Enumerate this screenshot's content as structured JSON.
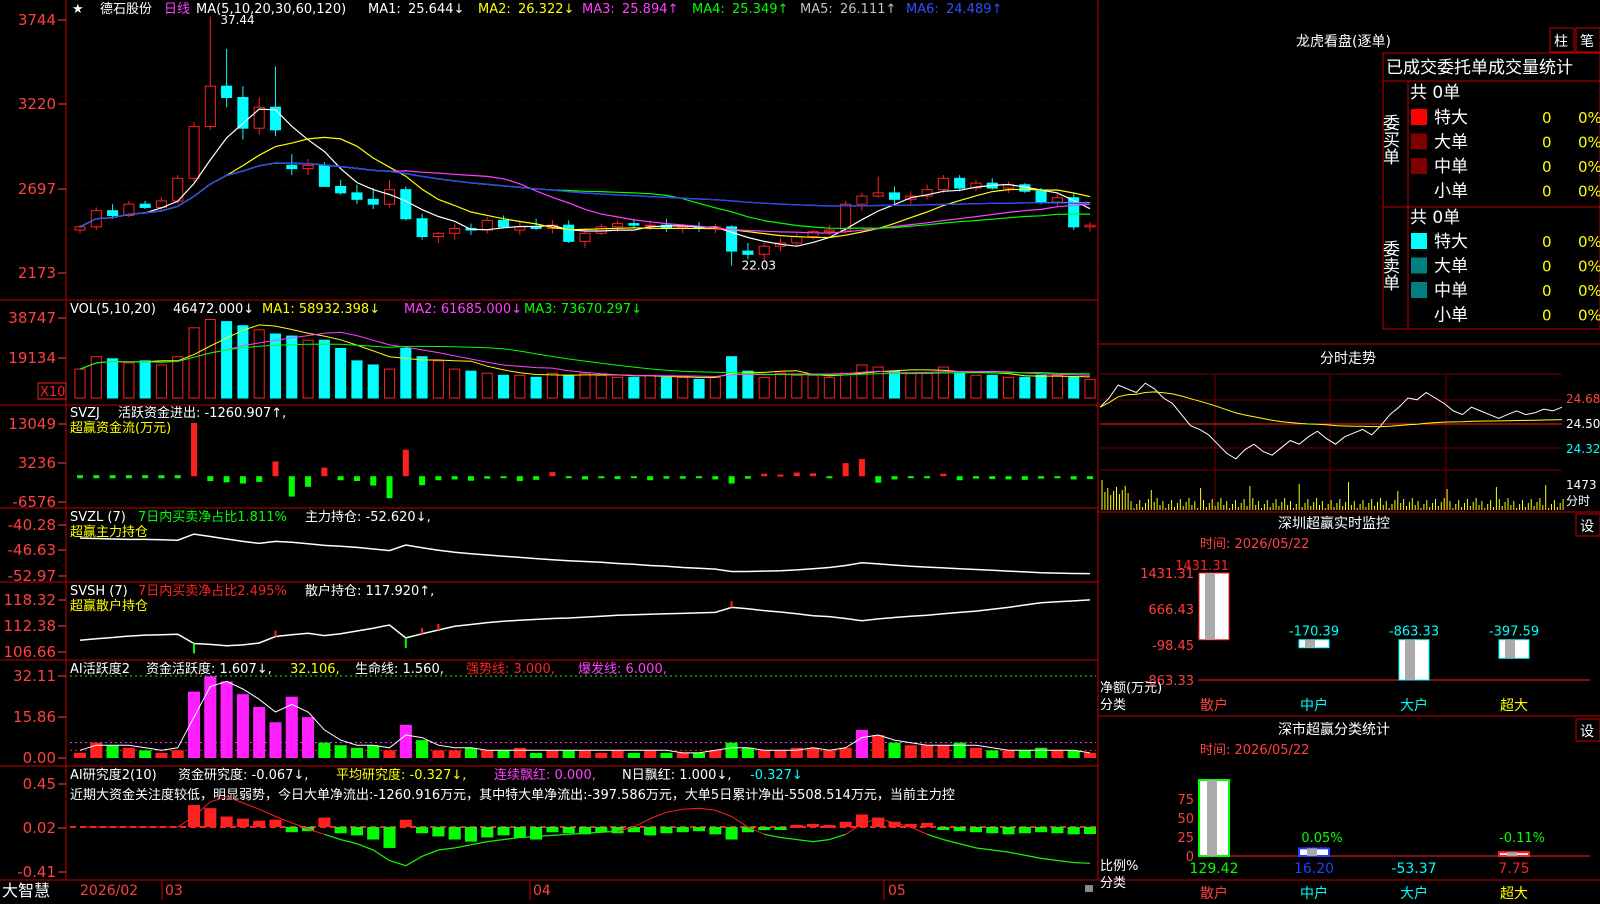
{
  "colors": {
    "up": "#ff2020",
    "down": "#00ffff",
    "grid": "#b00000",
    "axis": "#ff4040",
    "white": "#ffffff",
    "yellow": "#ffff00",
    "magenta": "#ff40ff",
    "green": "#00ff00",
    "blue": "#2040ff",
    "gray": "#c0c0c0"
  },
  "app": {
    "brand": "大智慧",
    "dates": {
      "start": "2026/02",
      "m03": "03",
      "m04": "04",
      "m05": "05"
    }
  },
  "price_panel": {
    "star": "★",
    "stock": "德石股份",
    "period": "日线",
    "ma_spec": "MA(5,10,20,30,60,120)",
    "ma1_label": "MA1:",
    "ma1_val": "25.644↓",
    "ma2_label": "MA2:",
    "ma2_val": "26.322↓",
    "ma3_label": "MA3:",
    "ma3_val": "25.894↑",
    "ma4_label": "MA4:",
    "ma4_val": "25.349↑",
    "ma5_label": "MA5:",
    "ma5_val": "26.111↑",
    "ma6_label": "MA6:",
    "ma6_val": "24.489↑",
    "high_note": "37.44",
    "low_note": "22.03",
    "y_ticks": [
      "3744",
      "3220",
      "2697",
      "2173"
    ],
    "ymax": 37.44,
    "ymin": 21.73
  },
  "vol_panel": {
    "title": "VOL(5,10,20)",
    "val": "46472.000↓",
    "ma1": "MA1: 58932.398↓",
    "ma2": "MA2: 61685.000↓",
    "ma3": "MA3: 73670.297↓",
    "y_ticks": [
      "38747",
      "19134"
    ],
    "scale": "X10"
  },
  "svzj_panel": {
    "title": "SVZJ",
    "label": "活跃资金进出: -1260.907↑,",
    "sub": "超赢资金流(万元)",
    "y_ticks": [
      "13049",
      "3236",
      "-6576"
    ]
  },
  "svzl_panel": {
    "title": "SVZL (7)",
    "label": "7日内买卖净占比1.811%",
    "label2": "主力持仓: -52.620↓,",
    "sub": "超赢主力持仓",
    "y_ticks": [
      "-40.28",
      "-46.63",
      "-52.97"
    ]
  },
  "svsh_panel": {
    "title": "SVSH (7)",
    "label": "7日内买卖净占比2.495%",
    "label2": "散户持仓: 117.920↑,",
    "sub": "超赢散户持仓",
    "y_ticks": [
      "118.32",
      "112.38",
      "106.66"
    ]
  },
  "ai_act_panel": {
    "title": "AI活跃度2",
    "l1": "资金活跃度: 1.607↓,",
    "l2": "32.106,",
    "l3": "生命线: 1.560,",
    "l4": "强势线: 3.000,",
    "l5": "爆发线: 6.000,",
    "y_ticks": [
      "32.11",
      "15.86",
      "0.00"
    ]
  },
  "ai_res_panel": {
    "title": "AI研究度2(10)",
    "l1": "资金研究度: -0.067↓,",
    "l2": "平均研究度: -0.327↓,",
    "l3": "连续飘红: 0.000,",
    "l4": "N日飘红: 1.000↓,",
    "l5": "-0.327↓",
    "note": "近期大资金关注度较低，明显弱势，今日大单净流出:-1260.916万元，其中特大单净流出:-397.586万元，大单5日累计净出-5508.514万元，当前主力控",
    "y_ticks": [
      "0.45",
      "0.02",
      "-0.41"
    ]
  },
  "lhb": {
    "title": "龙虎看盘(逐单)",
    "btn1": "柱",
    "btn2": "笔",
    "header": "已成交委托单成交量统计",
    "buy_side": "委买单",
    "sell_side": "委卖单",
    "buy_total": "共 0单",
    "sell_total": "共 0单",
    "buy_rows": [
      {
        "name": "特大",
        "n": "0",
        "p": "0%"
      },
      {
        "name": "大单",
        "n": "0",
        "p": "0%"
      },
      {
        "name": "中单",
        "n": "0",
        "p": "0%"
      },
      {
        "name": "小单",
        "n": "0",
        "p": "0%"
      }
    ],
    "sell_rows": [
      {
        "name": "特大",
        "n": "0",
        "p": "0%"
      },
      {
        "name": "大单",
        "n": "0",
        "p": "0%"
      },
      {
        "name": "中单",
        "n": "0",
        "p": "0%"
      },
      {
        "name": "小单",
        "n": "0",
        "p": "0%"
      }
    ]
  },
  "intraday": {
    "title": "分时走势",
    "y_ticks": [
      "24.68",
      "24.50",
      "24.32"
    ],
    "vol_tick": "1473",
    "vol_unit": "分时"
  },
  "sz_monitor": {
    "title": "深圳超赢实时监控",
    "btn": "设",
    "time": "时间: 2026/05/22",
    "y_ticks": [
      "1431.31",
      "666.43",
      "-98.45",
      "-863.33"
    ],
    "unit": "净额(万元)",
    "cat_label": "分类",
    "categories": [
      "散户",
      "中户",
      "大户",
      "超大"
    ],
    "values": [
      1431.31,
      -170.39,
      -863.33,
      -397.59
    ],
    "labels": [
      "1431.31",
      "-170.39",
      "-863.33",
      "-397.59"
    ]
  },
  "sh_stats": {
    "title": "深市超赢分类统计",
    "btn": "设",
    "time": "时间: 2026/05/22",
    "y_ticks": [
      "75",
      "50",
      "25",
      "0"
    ],
    "unit": "比例%",
    "cat_label": "分类",
    "categories": [
      "散户",
      "中户",
      "大户",
      "超大"
    ],
    "pcts": [
      0,
      0.05,
      0,
      0.11
    ],
    "pct_labels": [
      "",
      "0.05%",
      "",
      "-0.11%"
    ],
    "values": [
      "129.42",
      "16.20",
      "-53.37",
      "7.75"
    ]
  },
  "chart_data": {
    "type": "candlestick",
    "x_start": "2026/02",
    "month_labels": [
      "2026/02",
      "03",
      "04",
      "05"
    ],
    "ohlc": [
      [
        24.2,
        24.5,
        24.0,
        24.4
      ],
      [
        24.4,
        25.6,
        24.2,
        25.4
      ],
      [
        25.4,
        25.8,
        24.9,
        25.1
      ],
      [
        25.1,
        26.0,
        25.0,
        25.8
      ],
      [
        25.8,
        26.0,
        25.5,
        25.6
      ],
      [
        25.6,
        26.2,
        25.4,
        26.0
      ],
      [
        26.0,
        27.6,
        25.8,
        27.4
      ],
      [
        27.4,
        30.9,
        27.2,
        30.6
      ],
      [
        30.6,
        37.4,
        30.4,
        33.1
      ],
      [
        33.1,
        35.4,
        31.8,
        32.4
      ],
      [
        32.4,
        33.1,
        29.8,
        30.5
      ],
      [
        30.5,
        32.4,
        30.1,
        31.8
      ],
      [
        31.8,
        34.3,
        30.0,
        30.4
      ],
      [
        28.2,
        28.9,
        27.6,
        28.0
      ],
      [
        28.0,
        28.6,
        27.6,
        28.2
      ],
      [
        28.2,
        28.4,
        27.5,
        26.9
      ],
      [
        26.9,
        27.3,
        26.4,
        26.5
      ],
      [
        26.5,
        27.0,
        25.8,
        26.1
      ],
      [
        26.1,
        26.8,
        25.5,
        25.8
      ],
      [
        25.8,
        27.3,
        25.6,
        26.7
      ],
      [
        26.7,
        26.9,
        24.8,
        24.9
      ],
      [
        24.9,
        25.2,
        23.6,
        23.8
      ],
      [
        23.8,
        24.1,
        23.4,
        24.0
      ],
      [
        24.0,
        24.6,
        23.6,
        24.3
      ],
      [
        24.3,
        24.6,
        23.9,
        24.2
      ],
      [
        24.2,
        25.0,
        24.0,
        24.8
      ],
      [
        24.8,
        25.1,
        24.3,
        24.4
      ],
      [
        24.2,
        24.8,
        23.9,
        24.4
      ],
      [
        24.4,
        24.9,
        24.2,
        24.3
      ],
      [
        24.3,
        24.8,
        24.0,
        24.5
      ],
      [
        24.5,
        24.8,
        23.4,
        23.5
      ],
      [
        23.5,
        24.2,
        23.1,
        24.0
      ],
      [
        24.0,
        24.6,
        23.9,
        24.4
      ],
      [
        24.4,
        24.8,
        24.1,
        24.6
      ],
      [
        24.6,
        24.9,
        24.3,
        24.5
      ],
      [
        24.5,
        24.8,
        24.2,
        24.5
      ],
      [
        24.5,
        24.9,
        24.1,
        24.3
      ],
      [
        24.3,
        24.6,
        24.0,
        24.4
      ],
      [
        24.4,
        24.7,
        24.1,
        24.3
      ],
      [
        24.3,
        24.6,
        24.0,
        24.4
      ],
      [
        24.4,
        24.5,
        22.0,
        22.9
      ],
      [
        22.9,
        23.4,
        22.4,
        22.7
      ],
      [
        22.7,
        23.4,
        22.3,
        23.2
      ],
      [
        23.2,
        23.7,
        22.9,
        23.4
      ],
      [
        23.4,
        24.0,
        23.2,
        23.8
      ],
      [
        23.8,
        24.2,
        23.6,
        24.1
      ],
      [
        24.1,
        24.5,
        23.9,
        24.2
      ],
      [
        24.2,
        26.0,
        24.0,
        25.8
      ],
      [
        25.8,
        26.5,
        25.4,
        26.3
      ],
      [
        26.3,
        27.5,
        26.2,
        26.5
      ],
      [
        26.5,
        26.9,
        25.8,
        26.1
      ],
      [
        26.1,
        26.6,
        25.8,
        26.3
      ],
      [
        26.3,
        27.0,
        26.1,
        26.7
      ],
      [
        26.7,
        27.6,
        26.5,
        27.4
      ],
      [
        27.4,
        27.6,
        26.6,
        26.8
      ],
      [
        26.8,
        27.3,
        26.6,
        27.1
      ],
      [
        27.1,
        27.4,
        26.7,
        26.8
      ],
      [
        26.8,
        27.2,
        26.5,
        27.0
      ],
      [
        27.0,
        27.1,
        26.5,
        26.6
      ],
      [
        26.6,
        26.8,
        25.8,
        25.9
      ],
      [
        25.9,
        26.4,
        25.6,
        26.2
      ],
      [
        26.2,
        26.5,
        24.2,
        24.4
      ],
      [
        24.4,
        24.7,
        24.1,
        24.5
      ]
    ],
    "vol": [
      14,
      20,
      19,
      17,
      18,
      16,
      20,
      34,
      38,
      37,
      35,
      33,
      31,
      30,
      28,
      28,
      24,
      18,
      16,
      14,
      24,
      20,
      18,
      14,
      13,
      12,
      11,
      11,
      10,
      12,
      11,
      12,
      11,
      10,
      10,
      11,
      10,
      10,
      9,
      10,
      20,
      13,
      10,
      12,
      11,
      11,
      10,
      12,
      16,
      15,
      13,
      12,
      12,
      15,
      12,
      11,
      11,
      10,
      10,
      11,
      11,
      10,
      9
    ],
    "svzj": [
      0,
      0,
      0,
      0,
      0,
      0,
      0,
      13049,
      -1200,
      -1500,
      -1800,
      -1400,
      3600,
      -5000,
      -2600,
      2100,
      -1000,
      -1200,
      -2300,
      -5400,
      6500,
      -2200,
      -1000,
      -800,
      -1100,
      -600,
      -300,
      -1200,
      -900,
      1000,
      -400,
      -800,
      -500,
      -700,
      -300,
      -1000,
      -600,
      -600,
      -500,
      -800,
      -1800,
      -600,
      600,
      400,
      900,
      700,
      -300,
      3200,
      4200,
      -1600,
      -800,
      -400,
      -500,
      600,
      -1000,
      -600,
      -700,
      -800,
      -900,
      -600,
      -500,
      -800,
      -700
    ],
    "svzl": [
      -43.8,
      -43.9,
      -44.0,
      -44.1,
      -44.1,
      -44.2,
      -44.3,
      -42.8,
      -43.4,
      -44.0,
      -44.6,
      -45.1,
      -44.6,
      -44.8,
      -45.2,
      -45.6,
      -45.8,
      -46.1,
      -46.5,
      -46.9,
      -45.5,
      -46.2,
      -46.8,
      -47.3,
      -47.7,
      -48.0,
      -48.3,
      -48.6,
      -48.9,
      -49.2,
      -49.4,
      -49.6,
      -49.8,
      -50.1,
      -50.3,
      -50.6,
      -50.8,
      -51.1,
      -51.3,
      -51.5,
      -52.1,
      -52.1,
      -52.0,
      -51.9,
      -51.7,
      -51.4,
      -51.1,
      -50.6,
      -49.9,
      -50.2,
      -50.5,
      -50.8,
      -51.0,
      -51.2,
      -51.4,
      -51.6,
      -51.8,
      -52.0,
      -52.2,
      -52.4,
      -52.5,
      -52.6,
      -52.62
    ],
    "svsh": [
      109.2,
      109.5,
      109.8,
      110.1,
      110.3,
      110.4,
      110.5,
      108.5,
      108.3,
      108.0,
      108.2,
      108.6,
      110.0,
      110.4,
      110.7,
      110.2,
      110.6,
      111.2,
      111.8,
      112.5,
      109.7,
      110.6,
      111.4,
      112.2,
      112.6,
      113.0,
      113.3,
      113.5,
      113.7,
      113.9,
      114.0,
      114.2,
      114.4,
      114.6,
      114.7,
      114.8,
      114.9,
      115.0,
      115.1,
      115.2,
      116.3,
      116.0,
      115.6,
      115.3,
      114.9,
      114.5,
      114.3,
      113.9,
      113.4,
      113.8,
      114.1,
      114.4,
      114.6,
      114.9,
      115.2,
      115.5,
      115.9,
      116.3,
      116.8,
      117.3,
      117.5,
      117.7,
      117.92
    ],
    "ai_act": [
      2,
      6,
      5,
      4,
      3,
      2,
      3,
      26,
      32,
      30,
      25,
      20,
      14,
      24,
      16,
      6,
      5,
      4,
      5,
      3,
      13,
      7,
      3,
      3,
      4,
      3,
      3,
      4,
      2,
      3,
      3,
      3,
      2,
      3,
      2,
      3,
      2,
      2,
      2,
      3,
      6,
      4,
      3,
      3,
      4,
      4,
      3,
      4,
      11,
      9,
      6,
      5,
      5,
      5,
      6,
      4,
      3,
      3,
      3,
      4,
      3,
      3,
      2
    ],
    "ai_act_line": [
      3,
      5,
      5,
      5,
      4,
      3,
      4,
      16,
      28,
      30,
      27,
      23,
      18,
      21,
      18,
      11,
      7,
      5,
      5,
      4,
      9,
      8,
      5,
      4,
      4,
      3,
      3,
      3,
      3,
      3,
      3,
      3,
      3,
      3,
      3,
      3,
      3,
      2,
      2,
      3,
      4,
      4,
      3,
      3,
      3,
      4,
      3,
      4,
      8,
      9,
      7,
      6,
      5,
      5,
      5,
      5,
      4,
      3,
      3,
      3,
      3,
      3,
      2
    ],
    "ai_res": [
      0,
      0,
      0,
      0,
      0,
      0,
      0,
      0.21,
      0.18,
      0.1,
      0.08,
      0.06,
      0.07,
      -0.05,
      -0.04,
      0.09,
      -0.06,
      -0.08,
      -0.12,
      -0.2,
      0.07,
      -0.06,
      -0.09,
      -0.12,
      -0.14,
      -0.1,
      -0.08,
      -0.1,
      -0.12,
      -0.05,
      -0.06,
      -0.07,
      -0.05,
      -0.06,
      -0.05,
      -0.08,
      -0.06,
      -0.05,
      -0.04,
      -0.07,
      -0.12,
      -0.05,
      -0.03,
      -0.02,
      0.02,
      0.03,
      0.02,
      0.05,
      0.12,
      0.09,
      0.05,
      0.03,
      0.04,
      -0.02,
      -0.04,
      -0.05,
      -0.06,
      -0.07,
      -0.06,
      -0.05,
      -0.06,
      -0.07,
      -0.067
    ],
    "ai_res_avg": [
      0.02,
      0.02,
      0.02,
      0.02,
      0.02,
      0.02,
      0.02,
      0.12,
      0.26,
      0.31,
      0.25,
      0.19,
      0.12,
      0.06,
      0.0,
      -0.05,
      -0.1,
      -0.14,
      -0.2,
      -0.3,
      -0.35,
      -0.26,
      -0.2,
      -0.18,
      -0.15,
      -0.12,
      -0.1,
      -0.08,
      -0.07,
      -0.06,
      -0.05,
      -0.04,
      -0.03,
      -0.02,
      0.02,
      0.1,
      0.16,
      0.19,
      0.2,
      0.18,
      0.12,
      0.02,
      -0.05,
      -0.08,
      -0.1,
      -0.12,
      -0.1,
      -0.05,
      0.05,
      0.1,
      0.06,
      0.02,
      -0.05,
      -0.1,
      -0.14,
      -0.18,
      -0.2,
      -0.22,
      -0.25,
      -0.28,
      -0.3,
      -0.32,
      -0.327
    ],
    "intraday": [
      24.5,
      24.55,
      24.62,
      24.6,
      24.58,
      24.63,
      24.6,
      24.55,
      24.52,
      24.46,
      24.4,
      24.38,
      24.35,
      24.3,
      24.25,
      24.22,
      24.27,
      24.3,
      24.26,
      24.24,
      24.28,
      24.32,
      24.3,
      24.34,
      24.37,
      24.33,
      24.3,
      24.34,
      24.36,
      24.38,
      24.35,
      24.4,
      24.46,
      24.5,
      24.55,
      24.54,
      24.58,
      24.55,
      24.52,
      24.48,
      24.46,
      24.5,
      24.48,
      24.46,
      24.44,
      24.46,
      24.48,
      24.46,
      24.47,
      24.49,
      24.48,
      24.5
    ]
  }
}
